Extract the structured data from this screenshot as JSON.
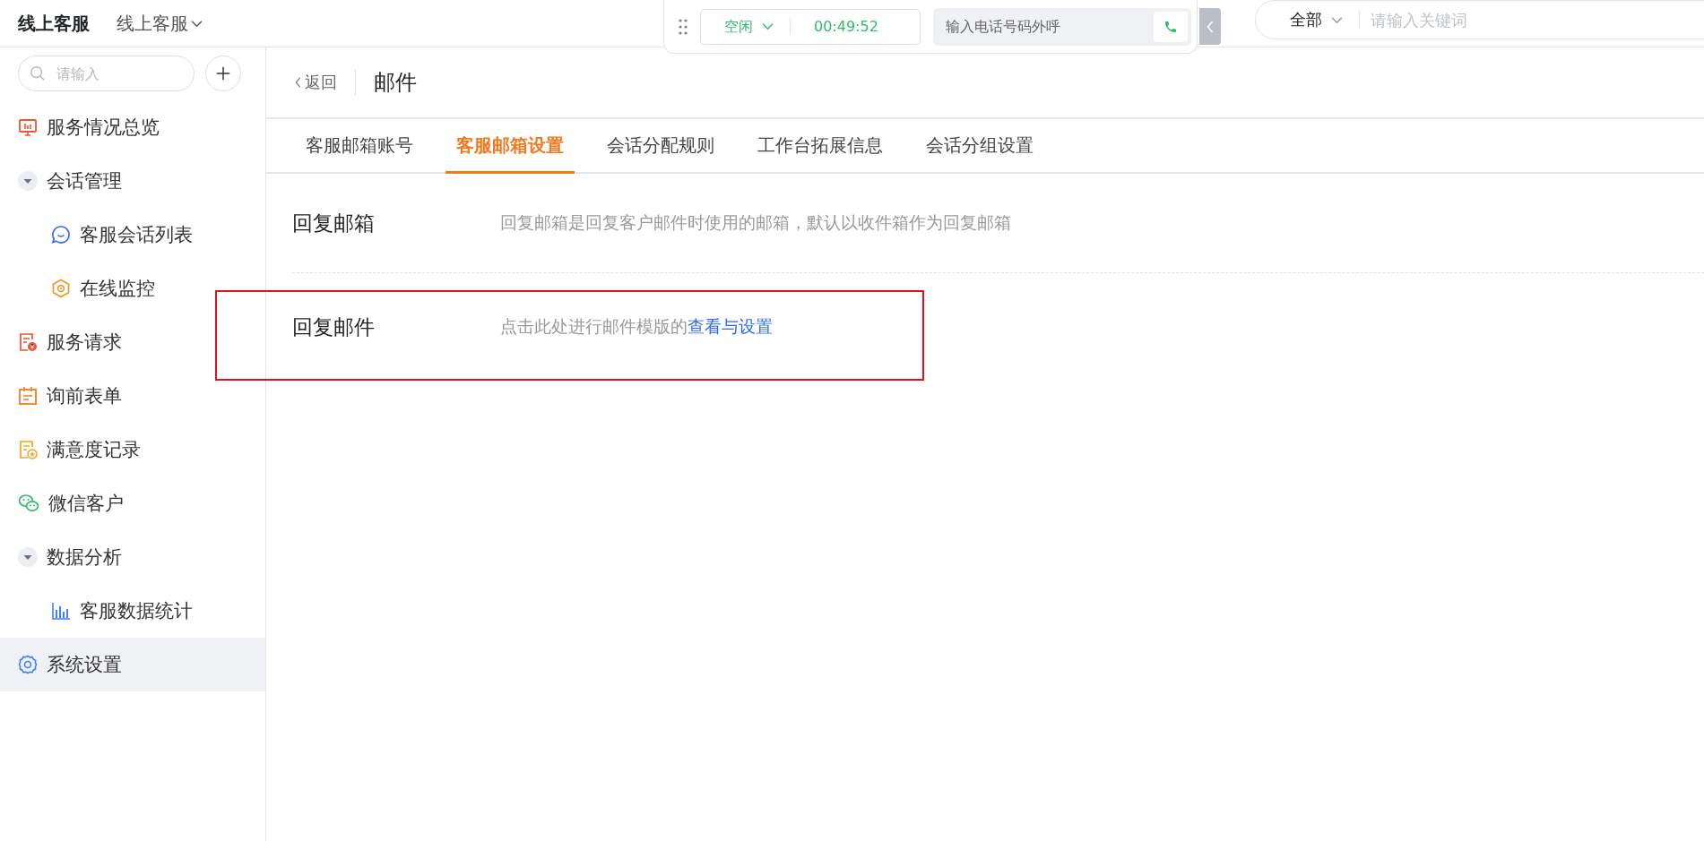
{
  "app": {
    "title": "线上客服",
    "switcher": "线上客服"
  },
  "call_bar": {
    "status": "空闲",
    "timer": "00:49:52",
    "phone_field": {
      "placeholder": "输入电话号码外呼"
    }
  },
  "search": {
    "scope": "全部",
    "placeholder": "请输入关键词"
  },
  "sidebar": {
    "search": {
      "placeholder": "请输入"
    },
    "items": [
      {
        "label": "服务情况总览",
        "selected": false
      },
      {
        "label": "会话管理",
        "selected": false,
        "expanded": true,
        "children": [
          {
            "label": "客服会话列表",
            "selected": false
          },
          {
            "label": "在线监控",
            "selected": false
          }
        ]
      },
      {
        "label": "服务请求",
        "selected": false
      },
      {
        "label": "询前表单",
        "selected": false
      },
      {
        "label": "满意度记录",
        "selected": false
      },
      {
        "label": "微信客户",
        "selected": false
      },
      {
        "label": "数据分析",
        "selected": false,
        "expanded": true,
        "children": [
          {
            "label": "客服数据统计",
            "selected": false
          }
        ]
      },
      {
        "label": "系统设置",
        "selected": true
      }
    ]
  },
  "page": {
    "back": "返回",
    "title": "邮件",
    "tabs": [
      {
        "label": "客服邮箱账号",
        "selected": false
      },
      {
        "label": "客服邮箱设置",
        "selected": true
      },
      {
        "label": "会话分配规则",
        "selected": false
      },
      {
        "label": "工作台拓展信息",
        "selected": false
      },
      {
        "label": "会话分组设置",
        "selected": false
      }
    ],
    "settings": [
      {
        "label": "回复邮箱",
        "description": "回复邮箱是回复客户邮件时使用的邮箱，默认以收件箱作为回复邮箱"
      },
      {
        "label": "回复邮件",
        "description": "点击此处进行邮件模版的",
        "link": "查看与设置"
      }
    ]
  }
}
